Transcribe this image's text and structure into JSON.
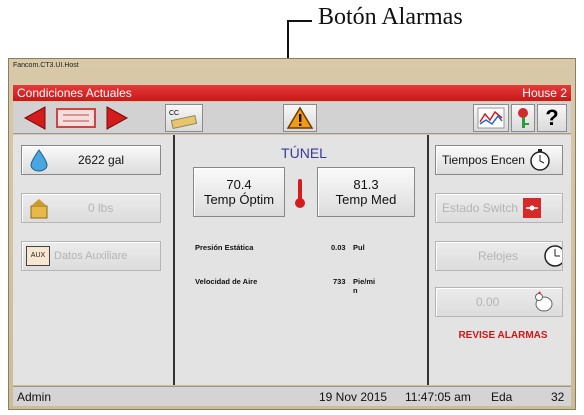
{
  "annotation": {
    "label": "Botón Alarmas"
  },
  "window": {
    "title": "Fancom.CT3.UI.Host"
  },
  "header": {
    "title": "Condiciones Actuales",
    "house": "House 2"
  },
  "toolbar": {
    "icons": [
      "arrow-left-icon",
      "house-map-icon",
      "arrow-right-icon",
      "cc-valve-icon",
      "alarm-warning-icon",
      "graph-icon",
      "key-icon",
      "help-icon"
    ],
    "help_label": "?",
    "cc_label": "CC"
  },
  "left_panel": {
    "water": "2622 gal",
    "feed": "0 lbs",
    "aux_tag": "AUX",
    "aux": "Datos Auxiliare"
  },
  "center_panel": {
    "mode": "TÚNEL",
    "temp_optim_value": "70.4",
    "temp_optim_label": "Temp Óptim",
    "temp_med_value": "81.3",
    "temp_med_label": "Temp Med",
    "rows": [
      {
        "label": "Presión Estática",
        "value": "0.03",
        "unit": "Pul"
      },
      {
        "label": "Velocidad de Aire",
        "value": "733",
        "unit": "Pie/mi",
        "unit_wrap": "n"
      }
    ]
  },
  "right_panel": {
    "tiempos": "Tiempos Encen",
    "estado": "Estado Switch",
    "relojes": "Relojes",
    "birds": "0.00",
    "warning": "REVISE ALARMAS"
  },
  "status": {
    "user": "Admin",
    "date": "19 Nov 2015",
    "time": "11:47:05 am",
    "age_label": "Eda",
    "age": "32"
  },
  "colors": {
    "accent": "#d41c1c",
    "tunel": "#3a3a9a",
    "warning": "#d01818"
  }
}
